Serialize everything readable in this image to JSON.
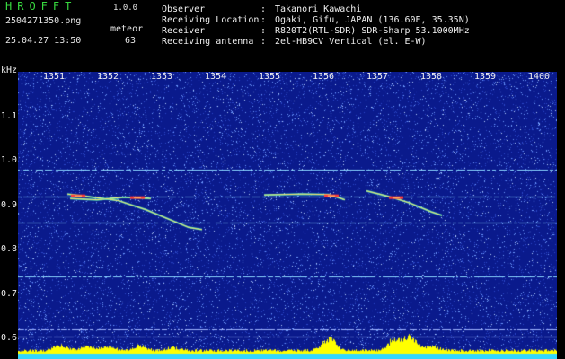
{
  "header": {
    "app_title": "HROFFT",
    "app_version": "1.0.0",
    "file_name": "2504271350.png",
    "timestamp": "25.04.27 13:50",
    "event_label": "meteor",
    "event_count": "63",
    "info": [
      {
        "label": "Observer",
        "value": "Takanori Kawachi"
      },
      {
        "label": "Receiving Location",
        "value": "Ogaki, Gifu, JAPAN (136.60E, 35.35N)"
      },
      {
        "label": "Receiver",
        "value": "R820T2(RTL-SDR) SDR-Sharp 53.1000MHz"
      },
      {
        "label": "Receiving antenna",
        "value": "2el-HB9CV Vertical (el. E-W)"
      }
    ]
  },
  "colors": {
    "background": "#000000",
    "plot_background": "#0a1a8c",
    "noise_light": "#6f9bff",
    "carrier_line": "#8ad7ff",
    "meteor_hot": "#ff3a3a",
    "meteor_warm": "#ffe36e",
    "level_fill": "#ffff00",
    "level_base": "#33d7ff",
    "title_green": "#37d83f"
  },
  "chart_data": {
    "type": "heatmap",
    "title": "",
    "xlabel": "",
    "ylabel": "kHz",
    "x_ticks": [
      "1351",
      "1352",
      "1353",
      "1354",
      "1355",
      "1356",
      "1357",
      "1358",
      "1359",
      "1400"
    ],
    "y_ticks": [
      "1.1",
      "1.0",
      "0.9",
      "0.8",
      "0.7",
      "0.6"
    ],
    "ylim": [
      0.57,
      1.2
    ],
    "carrier_lines_khz": [
      0.98,
      0.92,
      0.86,
      0.74,
      0.62,
      0.605
    ],
    "meteor_traces": [
      {
        "points": [
          [
            1351.25,
            0.925
          ],
          [
            1351.6,
            0.92
          ],
          [
            1352.2,
            0.91
          ],
          [
            1352.7,
            0.89
          ],
          [
            1353.1,
            0.87
          ],
          [
            1353.5,
            0.85
          ],
          [
            1353.75,
            0.845
          ]
        ],
        "peak": [
          1351.45,
          0.922
        ]
      },
      {
        "points": [
          [
            1351.3,
            0.915
          ],
          [
            1351.8,
            0.912
          ],
          [
            1352.3,
            0.918
          ],
          [
            1352.8,
            0.915
          ]
        ],
        "peak": [
          1352.55,
          0.918
        ]
      },
      {
        "points": [
          [
            1354.9,
            0.923
          ],
          [
            1355.6,
            0.925
          ],
          [
            1356.1,
            0.924
          ],
          [
            1356.4,
            0.912
          ]
        ],
        "peak": [
          1356.15,
          0.922
        ]
      },
      {
        "points": [
          [
            1356.8,
            0.932
          ],
          [
            1357.2,
            0.92
          ],
          [
            1357.6,
            0.905
          ],
          [
            1358.0,
            0.885
          ],
          [
            1358.2,
            0.877
          ]
        ],
        "peak": [
          1357.35,
          0.918
        ]
      }
    ],
    "legend": "none",
    "grid": false
  }
}
